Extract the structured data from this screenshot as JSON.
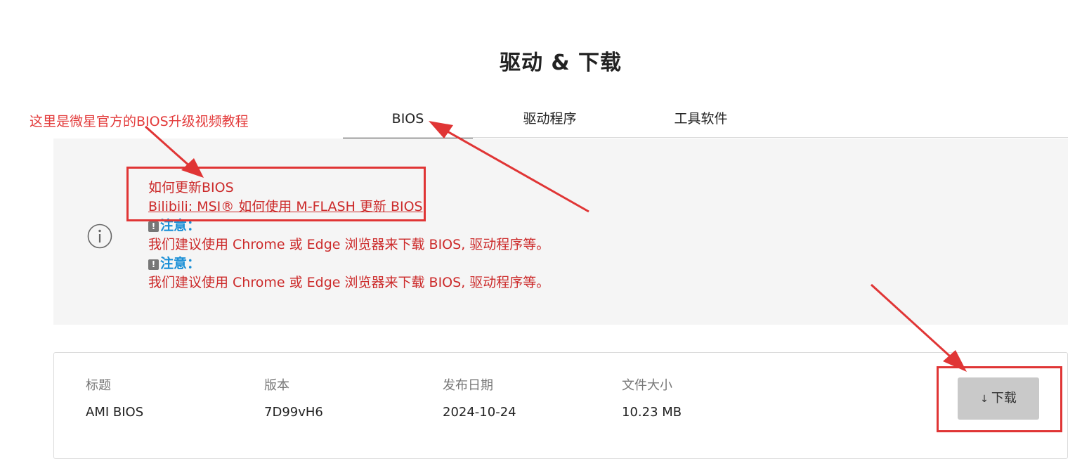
{
  "page": {
    "title": "驱动 & 下载"
  },
  "tabs": [
    {
      "label": "BIOS",
      "active": true
    },
    {
      "label": "驱动程序",
      "active": false
    },
    {
      "label": "工具软件",
      "active": false
    }
  ],
  "notice": {
    "icon": "info-icon",
    "how_to_title": "如何更新BIOS",
    "link_text": "Bilibili: MSI® 如何使用 M-FLASH 更新 BIOS",
    "warnings": [
      {
        "badge": "!",
        "label": "注意：",
        "text": "我们建议使用 Chrome 或 Edge 浏览器来下载 BIOS, 驱动程序等。"
      },
      {
        "badge": "!",
        "label": "注意：",
        "text": "我们建议使用 Chrome 或 Edge 浏览器来下载 BIOS, 驱动程序等。"
      }
    ]
  },
  "download": {
    "columns": [
      {
        "label": "标题",
        "value": "AMI BIOS"
      },
      {
        "label": "版本",
        "value": "7D99vH6"
      },
      {
        "label": "发布日期",
        "value": "2024-10-24"
      },
      {
        "label": "文件大小",
        "value": "10.23 MB"
      }
    ],
    "button_icon": "↓",
    "button_label": "下载"
  },
  "annotation": {
    "text": "这里是微星官方的BIOS升级视频教程",
    "color": "#e03535"
  },
  "colors": {
    "notice_text": "#cc2a2a",
    "warning_label": "#1a8fd6",
    "panel_bg": "#f5f5f5",
    "button_bg": "#c9c9c9"
  }
}
